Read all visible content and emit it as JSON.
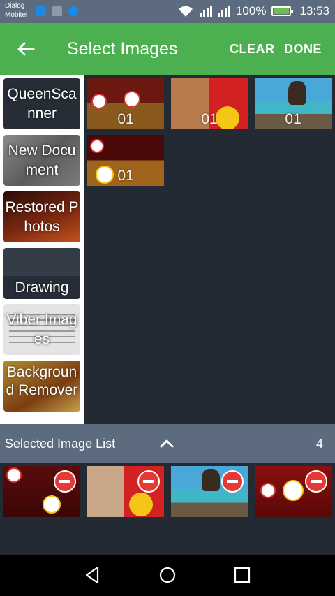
{
  "status_bar": {
    "carrier_line1": "Dialog",
    "carrier_line2": "Mobitel",
    "battery_text": "100%",
    "time": "13:53",
    "notification_icons": [
      "maps-icon",
      "gallery-icon",
      "chat-icon"
    ]
  },
  "app_bar": {
    "title": "Select Images",
    "clear_label": "CLEAR",
    "done_label": "DONE",
    "color": "#4caf50"
  },
  "folders": [
    {
      "label": "QueenScanner"
    },
    {
      "label": "New Document"
    },
    {
      "label": "Restored Photos"
    },
    {
      "label": "Drawing"
    },
    {
      "label": "Viber Images"
    },
    {
      "label": "Background Remover"
    }
  ],
  "grid": [
    {
      "count": "01"
    },
    {
      "count": "01"
    },
    {
      "count": "01"
    },
    {
      "count": "01"
    }
  ],
  "selected": {
    "label": "Selected Image List",
    "count": "4"
  },
  "colors": {
    "background": "#232a33",
    "bar": "#5d6b7e",
    "remove": "#e53935"
  }
}
